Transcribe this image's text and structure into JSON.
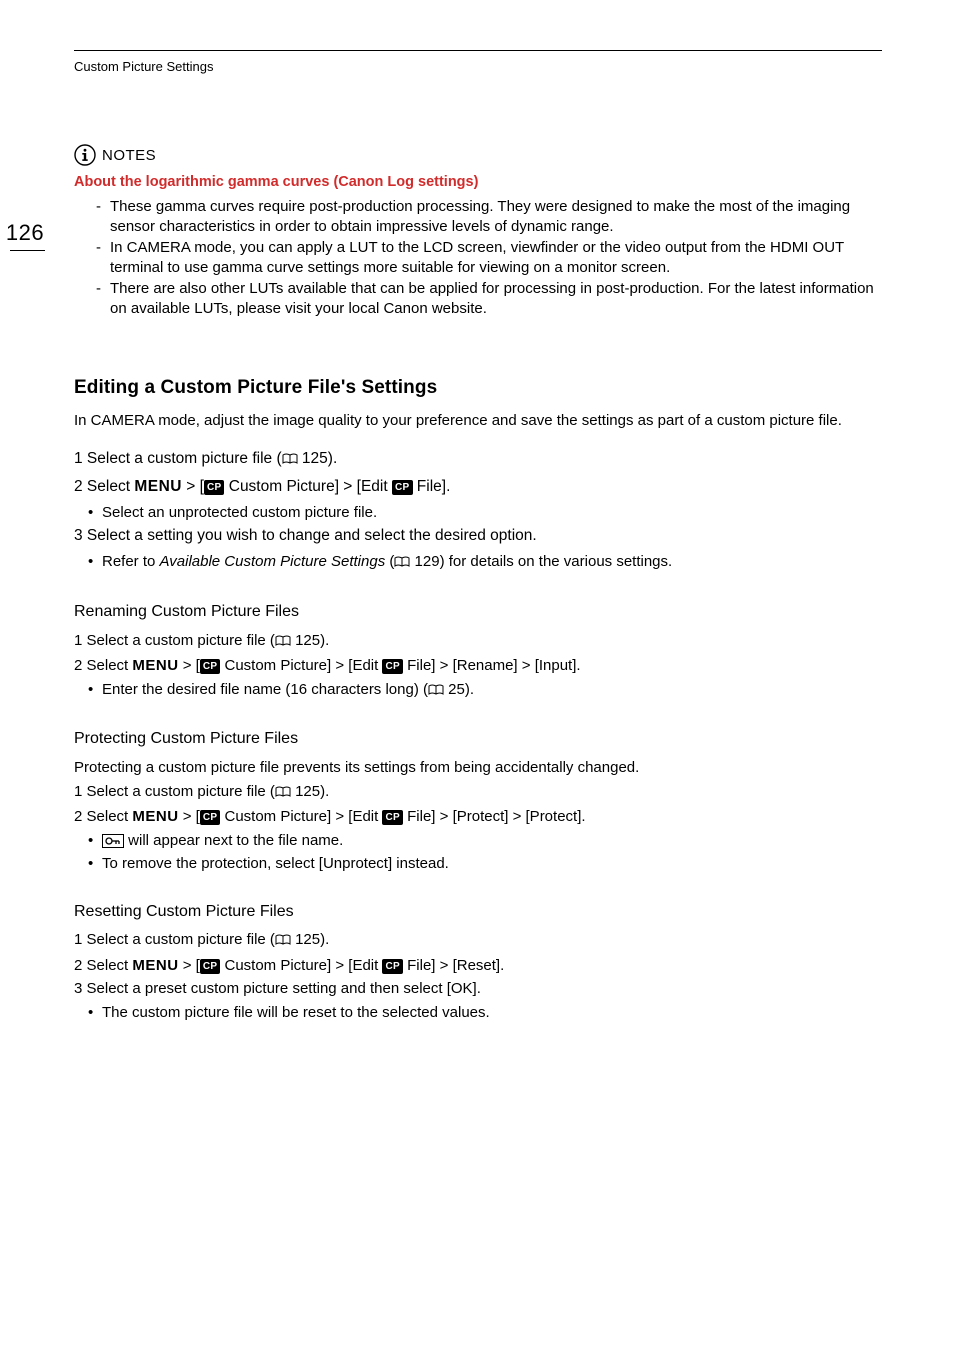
{
  "page_number": "126",
  "header_title": "Custom Picture Settings",
  "notes_label": "NOTES",
  "notes_heading": "About the logarithmic gamma curves (Canon Log settings)",
  "notes_items": [
    "These gamma curves require post-production processing. They were designed to make the most of the imaging sensor characteristics in order to obtain impressive levels of dynamic range.",
    "In CAMERA mode, you can apply a LUT to the LCD screen, viewfinder or the video output from the HDMI OUT terminal to use gamma curve settings more suitable for viewing on a monitor screen.",
    "There are also other LUTs available that can be applied for processing in post-production. For the latest information on available LUTs, please visit your local Canon website."
  ],
  "editing": {
    "title": "Editing a Custom Picture File's Settings",
    "intro": "In CAMERA mode, adjust the image quality to your preference and save the settings as part of a custom picture file.",
    "step1_a": "1 Select a custom picture file (",
    "step1_b": " 125).",
    "step2_a": "2 Select ",
    "step2_menu": "MENU",
    "step2_b": " > [",
    "step2_c": " Custom Picture] > [Edit ",
    "step2_d": " File].",
    "step2_sub": "Select an unprotected custom picture file.",
    "step3": "3 Select a setting you wish to change and select the desired option.",
    "step3_sub_a": "Refer to ",
    "step3_sub_i": "Available Custom Picture Settings",
    "step3_sub_b": " (",
    "step3_sub_c": " 129) for details on the various settings."
  },
  "renaming": {
    "title": "Renaming Custom Picture Files",
    "s1_a": "1 Select a custom picture file (",
    "s1_b": " 125).",
    "s2_a": "2 Select ",
    "s2_menu": "MENU",
    "s2_b": " > [",
    "s2_c": " Custom Picture] > [Edit ",
    "s2_d": " File] > [Rename] > [Input].",
    "s2_sub_a": "Enter the desired file name (16 characters long) (",
    "s2_sub_b": " 25)."
  },
  "protecting": {
    "title": "Protecting Custom Picture Files",
    "intro": "Protecting a custom picture file prevents its settings from being accidentally changed.",
    "s1_a": "1 Select a custom picture file (",
    "s1_b": " 125).",
    "s2_a": "2 Select ",
    "s2_menu": "MENU",
    "s2_b": " > [",
    "s2_c": " Custom Picture] > [Edit ",
    "s2_d": " File] > [Protect] > [Protect].",
    "s2_sub1": " will appear next to the file name.",
    "s2_sub2": "To remove the protection, select [Unprotect] instead."
  },
  "resetting": {
    "title": "Resetting Custom Picture Files",
    "s1_a": "1 Select a custom picture file (",
    "s1_b": " 125).",
    "s2_a": "2 Select ",
    "s2_menu": "MENU",
    "s2_b": " > [",
    "s2_c": " Custom Picture] > [Edit ",
    "s2_d": " File] > [Reset].",
    "s3": "3 Select a preset custom picture setting and then select [OK].",
    "s3_sub": "The custom picture file will be reset to the selected values."
  },
  "glyphs": {
    "menu": "MENU",
    "cp": "CP"
  }
}
